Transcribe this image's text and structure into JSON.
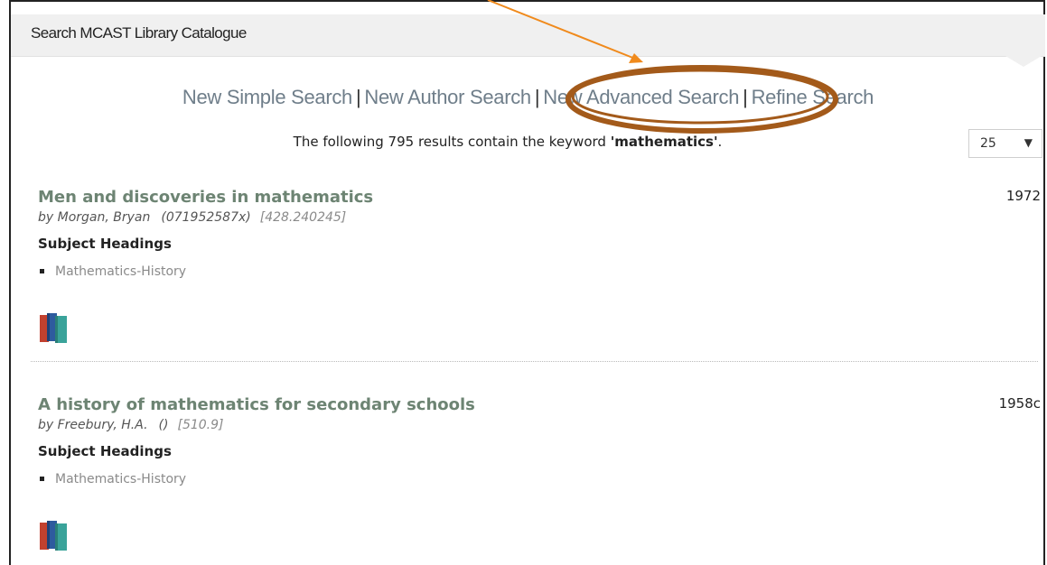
{
  "panel": {
    "title": "Search MCAST Library Catalogue"
  },
  "nav": {
    "links": [
      "New Simple Search",
      "New Author Search",
      "New Advanced Search",
      "Refine Search"
    ],
    "separator": "|"
  },
  "summary": {
    "prefix": "The following 795 results contain the keyword",
    "keyword": "'mathematics'",
    "suffix": "."
  },
  "per_page": {
    "value": "25"
  },
  "results": [
    {
      "title": "Men and discoveries in mathematics",
      "year": "1972",
      "author": "by  Morgan, Bryan",
      "isbn": "(071952587x)",
      "call_number": "[428.240245]",
      "subject_heading_label": "Subject Headings",
      "subject": "Mathematics-History"
    },
    {
      "title": "A history of mathematics for secondary schools",
      "year": "1958c",
      "author": "by  Freebury, H.A.",
      "isbn": "()",
      "call_number": "[510.9]",
      "subject_heading_label": "Subject Headings",
      "subject": "Mathematics-History"
    }
  ],
  "annotation": {
    "arrow_color": "#f08a1c",
    "circle_color": "#a35a1a"
  },
  "colors": {
    "title_green": "#6d8473",
    "link_gray": "#6f7e8a"
  }
}
